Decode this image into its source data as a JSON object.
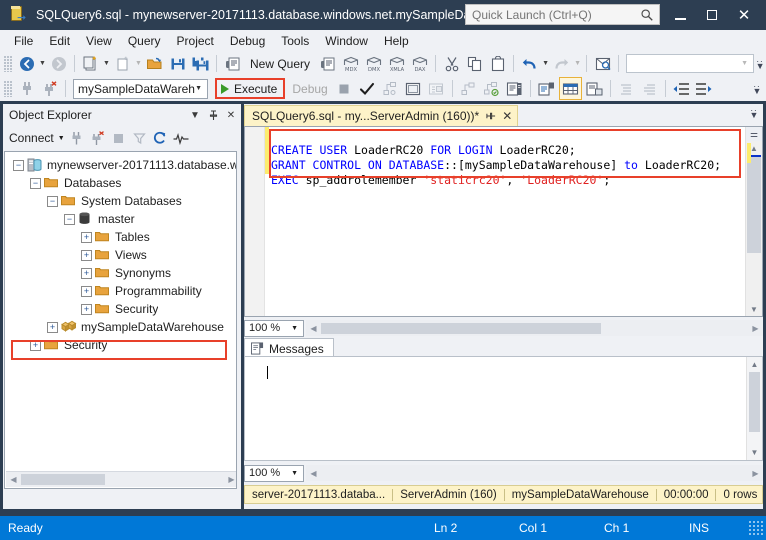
{
  "window": {
    "title": "SQLQuery6.sql - mynewserver-20171113.database.windows.net.mySampleDa...",
    "app_icon": "ssms-icon",
    "minimize_label": "Minimize",
    "maximize_label": "Maximize",
    "close_label": "Close"
  },
  "quick_launch": {
    "placeholder": "Quick Launch (Ctrl+Q)",
    "value": "",
    "icon": "search-icon"
  },
  "menubar": {
    "items": [
      {
        "label": "File"
      },
      {
        "label": "Edit"
      },
      {
        "label": "View"
      },
      {
        "label": "Query"
      },
      {
        "label": "Project"
      },
      {
        "label": "Debug"
      },
      {
        "label": "Tools"
      },
      {
        "label": "Window"
      },
      {
        "label": "Help"
      }
    ]
  },
  "toolbar_main": {
    "navigate_back": "navigate-back-icon",
    "navigate_forward": "navigate-forward-icon",
    "new_project": "new-project-icon",
    "new_item": "new-item-icon",
    "open_file": "open-file-icon",
    "save": "save-icon",
    "save_all": "save-all-icon",
    "new_query_label": "New Query",
    "new_query_db_icon": "database-query-icon",
    "mdx_query": "mdx-query-icon",
    "dmx_query": "dmx-query-icon",
    "xmla_query": "xmla-query-icon",
    "dax_query": "dax-query-icon",
    "cut": "cut-icon",
    "copy": "copy-icon",
    "paste": "paste-icon",
    "undo": "undo-icon",
    "redo": "redo-icon",
    "find": "find-icon",
    "combo_value": "",
    "overflow": "toolbar-overflow-icon"
  },
  "toolbar_query": {
    "connect_icon": "connect-icon",
    "disconnect_icon": "disconnect-icon",
    "database_selector": {
      "value": "mySampleDataWarehouse",
      "chevron": "chevron-down-icon"
    },
    "execute_label": "Execute",
    "execute_icon": "play-icon",
    "execute_highlighted": true,
    "debug_label": "Debug",
    "debug_enabled": false,
    "stop_icon": "stop-icon",
    "parse_icon": "check-icon",
    "display_estimated_plan": "estimated-plan-icon",
    "query_options": "query-options-icon",
    "intellisense": "intellisense-icon",
    "include_actual_plan": "actual-plan-icon",
    "include_client_stats": "client-stats-icon",
    "sqlcmd_mode": "sqlcmd-mode-icon",
    "results_to_text": "results-to-text-icon",
    "results_to_grid": "results-to-grid-icon",
    "results_to_file": "results-to-file-icon",
    "results_to_grid_selected": true,
    "comment_lines": "comment-icon",
    "uncomment_lines": "uncomment-icon",
    "decrease_indent": "decrease-indent-icon",
    "increase_indent": "increase-indent-icon",
    "overflow": "toolbar-overflow-icon"
  },
  "object_explorer": {
    "title": "Object Explorer",
    "window_dropdown_icon": "chevron-down-icon",
    "pin_icon": "pin-icon",
    "close_icon": "close-icon",
    "toolbar": {
      "connect_label": "Connect",
      "connect_chevron": "chevron-down-icon",
      "connect_object_explorer": "connect-plug-icon",
      "disconnect": "disconnect-plug-icon",
      "stop": "stop-icon",
      "filter": "filter-icon",
      "refresh": "refresh-icon",
      "activity_monitor": "activity-monitor-icon"
    },
    "tree": [
      {
        "label": "mynewserver-20171113.database.w",
        "depth": 0,
        "expander": "minus",
        "icon": "server-icon",
        "highlighted": false
      },
      {
        "label": "Databases",
        "depth": 1,
        "expander": "minus",
        "icon": "folder-icon",
        "highlighted": false
      },
      {
        "label": "System Databases",
        "depth": 2,
        "expander": "minus",
        "icon": "folder-icon",
        "highlighted": false
      },
      {
        "label": "master",
        "depth": 3,
        "expander": "minus",
        "icon": "database-icon",
        "highlighted": false
      },
      {
        "label": "Tables",
        "depth": 4,
        "expander": "plus",
        "icon": "folder-icon",
        "highlighted": false
      },
      {
        "label": "Views",
        "depth": 4,
        "expander": "plus",
        "icon": "folder-icon",
        "highlighted": false
      },
      {
        "label": "Synonyms",
        "depth": 4,
        "expander": "plus",
        "icon": "folder-icon",
        "highlighted": false
      },
      {
        "label": "Programmability",
        "depth": 4,
        "expander": "plus",
        "icon": "folder-icon",
        "highlighted": false
      },
      {
        "label": "Security",
        "depth": 4,
        "expander": "plus",
        "icon": "folder-icon",
        "highlighted": false
      },
      {
        "label": "mySampleDataWarehouse",
        "depth": 2,
        "expander": "plus",
        "icon": "datawarehouse-icon",
        "highlighted": true
      },
      {
        "label": "Security",
        "depth": 1,
        "expander": "plus",
        "icon": "folder-icon",
        "highlighted": false
      }
    ],
    "hscroll": {
      "left_arrow": "left-arrow-icon",
      "right_arrow": "right-arrow-icon"
    }
  },
  "editor": {
    "tab": {
      "label": "SQLQuery6.sql - my...ServerAdmin (160))*",
      "pin_icon": "pin-icon",
      "close_icon": "close-icon"
    },
    "tabstrip_overflow": "tab-overflow-icon",
    "code_lines": [
      [
        {
          "t": "CREATE USER ",
          "c": "kw"
        },
        {
          "t": "LoaderRC20 ",
          "c": "id"
        },
        {
          "t": "FOR LOGIN ",
          "c": "kw"
        },
        {
          "t": "LoaderRC20;",
          "c": "id"
        }
      ],
      [
        {
          "t": "GRANT CONTROL ON DATABASE",
          "c": "kw"
        },
        {
          "t": "::[mySampleDataWarehouse] ",
          "c": "id"
        },
        {
          "t": "to ",
          "c": "kw"
        },
        {
          "t": "LoaderRC20;",
          "c": "id"
        }
      ],
      [
        {
          "t": "EXEC ",
          "c": "kw"
        },
        {
          "t": "sp_addrolemember ",
          "c": "id"
        },
        {
          "t": "'staticrc20'",
          "c": "str"
        },
        {
          "t": ", ",
          "c": "id"
        },
        {
          "t": "'LoaderRC20'",
          "c": "str"
        },
        {
          "t": ";",
          "c": "id"
        }
      ]
    ],
    "code_highlighted": true,
    "zoom_level": "100 %",
    "zoom_chevron": "chevron-down-icon"
  },
  "results": {
    "tabs": [
      {
        "label": "Messages",
        "icon": "messages-icon",
        "active": true
      }
    ],
    "message_text": "",
    "zoom_level": "100 %",
    "zoom_chevron": "chevron-down-icon"
  },
  "query_status": {
    "server": "server-20171113.databa...",
    "user": "ServerAdmin (160)",
    "database": "mySampleDataWarehouse",
    "elapsed": "00:00:00",
    "rows": "0 rows"
  },
  "statusbar": {
    "state": "Ready",
    "line": "Ln 2",
    "column": "Col 1",
    "character": "Ch 1",
    "insert_mode": "INS"
  },
  "colors": {
    "titlebar": "#2d3e52",
    "accent_blue": "#0078d7",
    "highlight_red": "#e8402a",
    "tab_yellow": "#fdf3c8",
    "keyword_blue": "#0000ff",
    "string_red": "#e02020",
    "execute_green": "#3a9a28"
  }
}
